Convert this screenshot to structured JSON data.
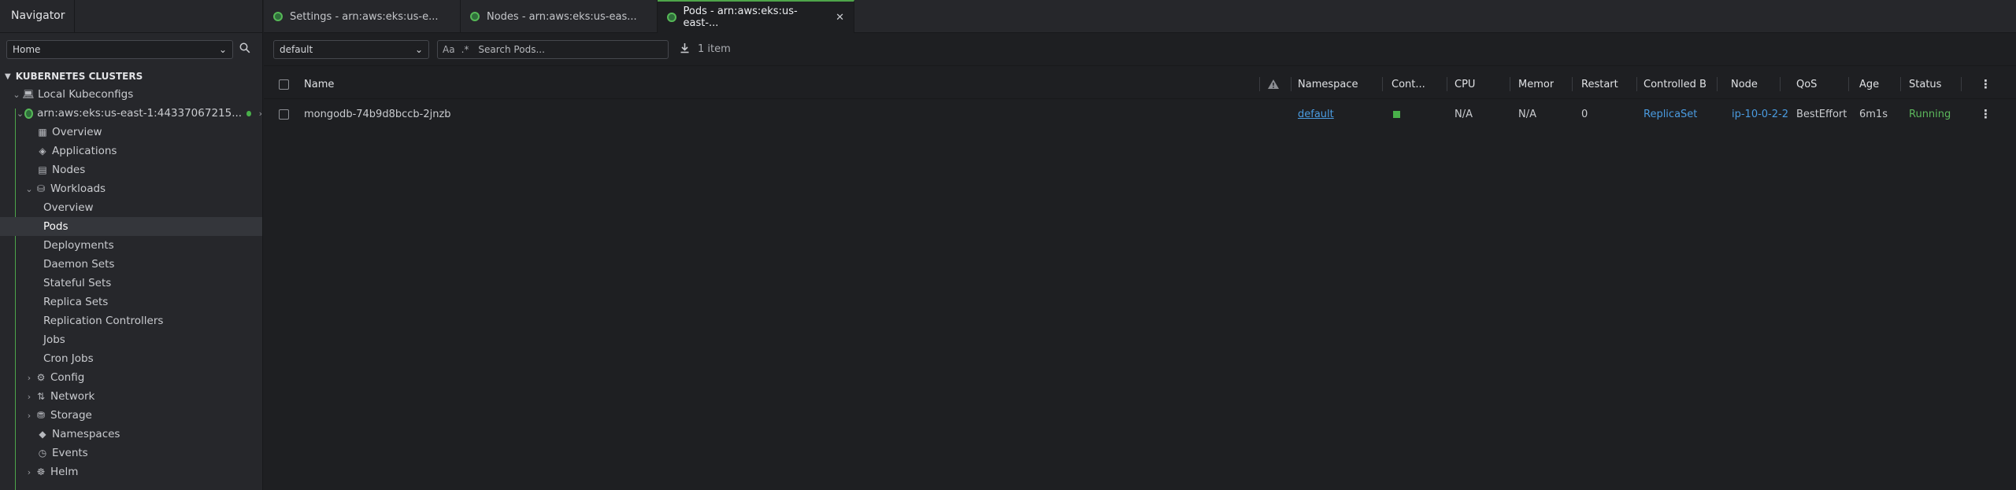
{
  "navigator": {
    "tab_label": "Navigator",
    "hotbar_select": "Home",
    "section_title": "KUBERNETES CLUSTERS",
    "local_kubeconfigs": "Local Kubeconfigs",
    "cluster_name": "arn:aws:eks:us-east-1:44337067215...",
    "items": {
      "overview": "Overview",
      "applications": "Applications",
      "nodes": "Nodes",
      "workloads": "Workloads",
      "wl_overview": "Overview",
      "pods": "Pods",
      "deployments": "Deployments",
      "daemon_sets": "Daemon Sets",
      "stateful_sets": "Stateful Sets",
      "replica_sets": "Replica Sets",
      "replication_controllers": "Replication Controllers",
      "jobs": "Jobs",
      "cron_jobs": "Cron Jobs",
      "config": "Config",
      "network": "Network",
      "storage": "Storage",
      "namespaces": "Namespaces",
      "events": "Events",
      "helm": "Helm"
    }
  },
  "tabs": [
    {
      "label": "Settings - arn:aws:eks:us-e..."
    },
    {
      "label": "Nodes - arn:aws:eks:us-eas..."
    },
    {
      "label": "Pods - arn:aws:eks:us-east-..."
    }
  ],
  "toolbar": {
    "namespace_select": "default",
    "search_placeholder": "Search Pods...",
    "match_case": "Aa",
    "item_count": "1 item"
  },
  "table": {
    "headers": {
      "name": "Name",
      "namespace": "Namespace",
      "containers": "Cont...",
      "cpu": "CPU",
      "memory": "Memor",
      "restarts": "Restart",
      "controlled_by": "Controlled B",
      "node": "Node",
      "qos": "QoS",
      "age": "Age",
      "status": "Status"
    },
    "rows": [
      {
        "name": "mongodb-74b9d8bccb-2jnzb",
        "namespace": "default",
        "cpu": "N/A",
        "memory": "N/A",
        "restarts": "0",
        "controlled_by": "ReplicaSet",
        "node": "ip-10-0-2-2",
        "qos": "BestEffort",
        "age": "6m1s",
        "status": "Running"
      }
    ]
  },
  "colors": {
    "accent_green": "#4ea54a",
    "link_blue": "#4a9be0",
    "status_running": "#5cb85c"
  }
}
